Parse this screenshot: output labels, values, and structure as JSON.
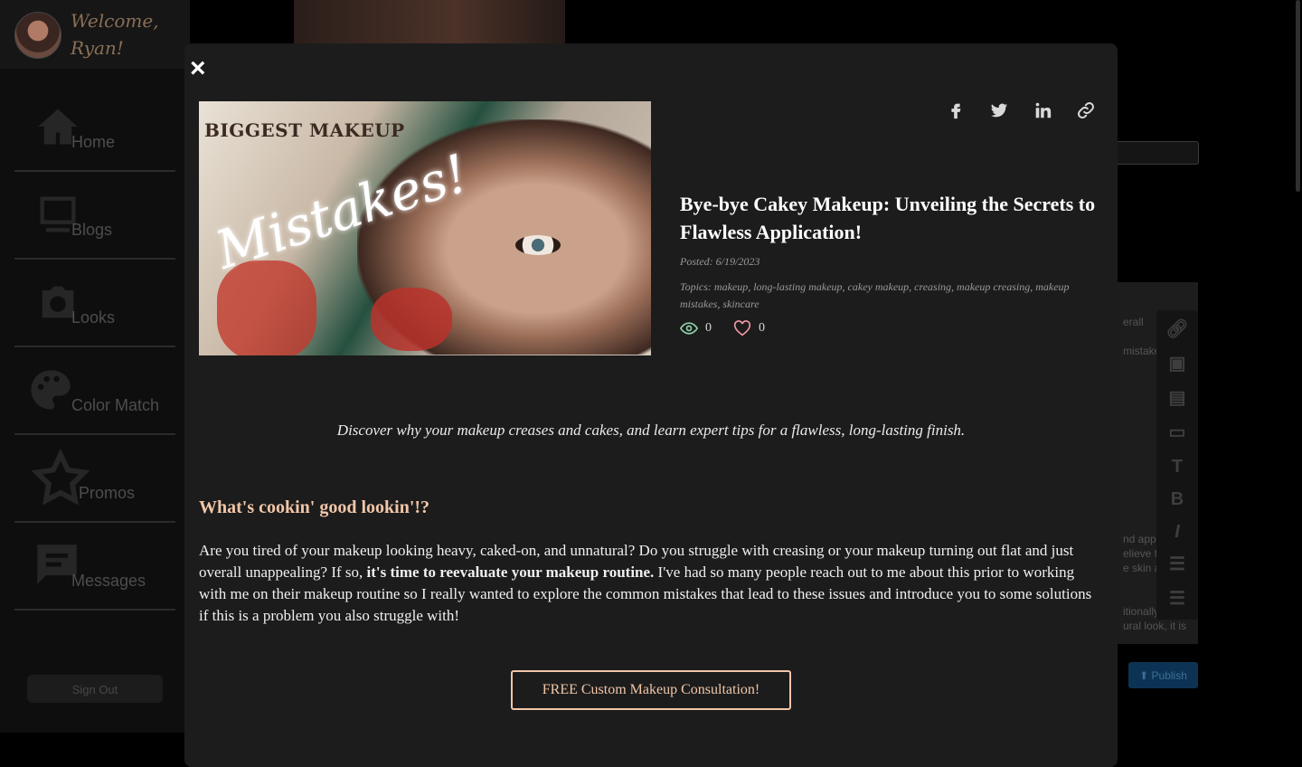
{
  "sidebar": {
    "welcome": "Welcome, Ryan!",
    "items": [
      {
        "label": "Home",
        "icon": "home-icon"
      },
      {
        "label": "Blogs",
        "icon": "blog-icon"
      },
      {
        "label": "Looks",
        "icon": "camera-icon"
      },
      {
        "label": "Color Match",
        "icon": "palette-icon"
      },
      {
        "label": "Promos",
        "icon": "star-icon"
      },
      {
        "label": "Messages",
        "icon": "chat-icon"
      }
    ],
    "sign_out": "Sign Out"
  },
  "background": {
    "editor_fragments": [
      "erall",
      "mistakes",
      "nd app",
      "elieve t",
      "e skin a",
      "itionally",
      "ural look, it is"
    ],
    "toolbar_tools": [
      "link-icon",
      "image-icon",
      "video-icon",
      "embed-icon",
      "text-icon",
      "bold-icon",
      "italic-icon",
      "bullet-list-icon",
      "numbered-list-icon"
    ],
    "publish_label": "Publish"
  },
  "modal": {
    "close_label": "×",
    "hero": {
      "heading": "BIGGEST MAKEUP",
      "script": "Mistakes!"
    },
    "share_icons": [
      "facebook-icon",
      "twitter-icon",
      "linkedin-icon",
      "link-icon"
    ],
    "title": "Bye-bye Cakey Makeup: Unveiling the Secrets to Flawless Application!",
    "posted": "Posted: 6/19/2023",
    "topics": "Topics: makeup, long-lasting makeup, cakey makeup, creasing, makeup creasing, makeup mistakes, skincare",
    "views": "0",
    "likes": "0",
    "summary": "Discover why your makeup creases and cakes, and learn expert tips for a flawless, long-lasting finish.",
    "section_heading": "What's cookin' good lookin'!?",
    "body_before": "Are you tired of your makeup looking heavy, caked-on, and unnatural? Do you struggle with creasing or your makeup turning out flat and just overall unappealing? If so, ",
    "body_bold": "it's time to reevaluate your makeup routine.",
    "body_after": " I've had so many people reach out to me about this prior to working with me on their makeup routine so I really wanted to explore the common mistakes that lead to these issues and introduce you to some solutions if this is a problem you also struggle with!",
    "cta": "FREE Custom Makeup Consultation!"
  },
  "colors": {
    "accent": "#f2c6a8",
    "modal_bg": "#1c1c1c",
    "publish_blue": "#0d3354"
  }
}
